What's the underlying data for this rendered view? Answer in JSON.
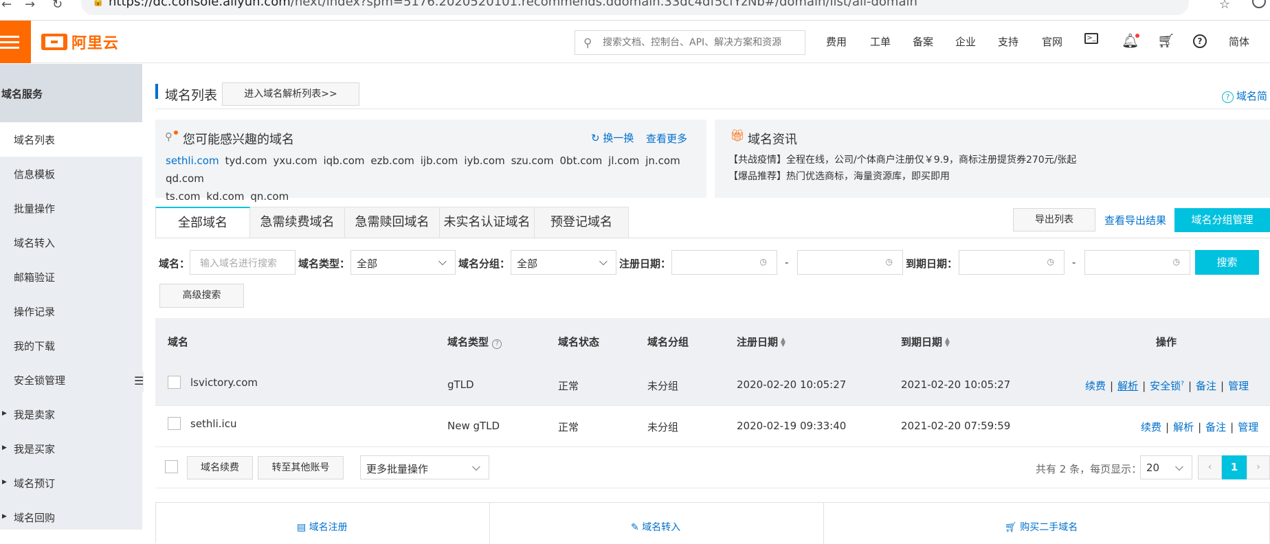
{
  "browser": {
    "url_prefix": "https://dc.console.aliyun.com",
    "url_rest": "/next/index?spm=5176.2020520101.recommends.ddomain.33dc4df5cfYzNb#/domain/list/all-domain"
  },
  "header": {
    "logo_text": "阿里云",
    "search_placeholder": "搜索文档、控制台、API、解决方案和资源",
    "nav": [
      "费用",
      "工单",
      "备案",
      "企业",
      "支持",
      "官网"
    ],
    "lang": "简体"
  },
  "sidebar": {
    "title": "域名服务",
    "items": [
      {
        "label": "域名列表",
        "active": true
      },
      {
        "label": "信息模板"
      },
      {
        "label": "批量操作"
      },
      {
        "label": "域名转入"
      },
      {
        "label": "邮箱验证"
      },
      {
        "label": "操作记录"
      },
      {
        "label": "我的下载"
      },
      {
        "label": "安全锁管理"
      },
      {
        "label": "我是卖家",
        "expandable": true
      },
      {
        "label": "我是买家",
        "expandable": true
      },
      {
        "label": "域名预订",
        "expandable": true
      },
      {
        "label": "域名回购",
        "expandable": true
      }
    ]
  },
  "page": {
    "title": "域名列表",
    "dns_button": "进入域名解析列表>>",
    "help_link": "域名简"
  },
  "interest": {
    "title": "您可能感兴趣的域名",
    "refresh": "换一换",
    "more": "查看更多",
    "domains": [
      "sethli.com",
      "tyd.com",
      "yxu.com",
      "iqb.com",
      "ezb.com",
      "ijb.com",
      "iyb.com",
      "szu.com",
      "0bt.com",
      "jl.com",
      "jn.com",
      "qd.com",
      "ts.com",
      "kd.com",
      "qn.com"
    ]
  },
  "news": {
    "title": "域名资讯",
    "lines": [
      "【共战疫情】全程在线，公司/个体商户注册仅￥9.9，商标注册提货券270元/张起",
      "【爆品推荐】热门优选商标，海量资源库，即买即用"
    ]
  },
  "tabs": [
    "全部域名",
    "急需续费域名",
    "急需赎回域名",
    "未实名认证域名",
    "预登记域名"
  ],
  "actions": {
    "export": "导出列表",
    "view_export": "查看导出结果",
    "group_manage": "域名分组管理"
  },
  "filters": {
    "domain_label": "域名：",
    "domain_placeholder": "输入域名进行搜索",
    "type_label": "域名类型：",
    "type_value": "全部",
    "group_label": "域名分组：",
    "group_value": "全部",
    "reg_label": "注册日期：",
    "exp_label": "到期日期：",
    "dash": "-",
    "search": "搜索",
    "advanced": "高级搜索"
  },
  "table": {
    "headers": {
      "domain": "域名",
      "type": "域名类型",
      "status": "域名状态",
      "group": "域名分组",
      "reg": "注册日期",
      "exp": "到期日期",
      "ops": "操作"
    },
    "rows": [
      {
        "domain": "lsvictory.com",
        "type": "gTLD",
        "status": "正常",
        "group": "未分组",
        "reg": "2020-02-20 10:05:27",
        "exp": "2021-02-20 10:05:27",
        "ops": [
          "续费",
          "解析",
          "安全锁",
          "备注",
          "管理"
        ]
      },
      {
        "domain": "sethli.icu",
        "type": "New gTLD",
        "status": "正常",
        "group": "未分组",
        "reg": "2020-02-19 09:33:40",
        "exp": "2021-02-20 07:59:59",
        "ops": [
          "续费",
          "解析",
          "备注",
          "管理"
        ]
      }
    ]
  },
  "bulk": {
    "renew": "域名续费",
    "transfer": "转至其他账号",
    "more": "更多批量操作"
  },
  "pagination": {
    "summary": "共有 2 条，每页显示：",
    "page_size": "20",
    "prev": "‹",
    "current": "1",
    "next": "›"
  },
  "bottom": {
    "register": "域名注册",
    "transfer_in": "域名转入",
    "buy_second": "购买二手域名"
  }
}
